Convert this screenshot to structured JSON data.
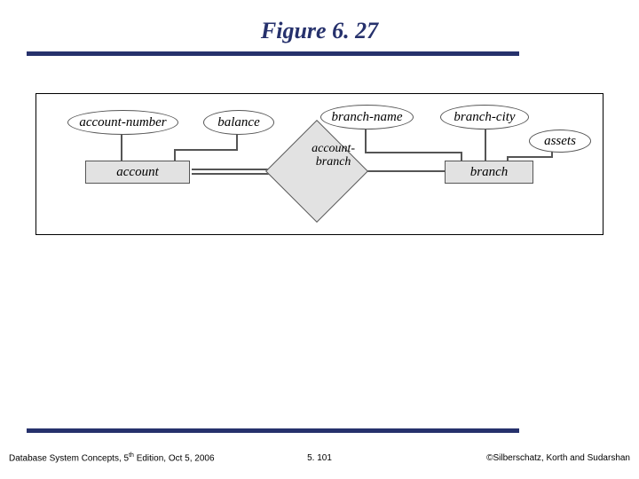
{
  "title": "Figure 6. 27",
  "er": {
    "attributes": {
      "account_number": "account-number",
      "balance": "balance",
      "branch_name": "branch-name",
      "branch_city": "branch-city",
      "assets": "assets"
    },
    "entities": {
      "account": "account",
      "branch": "branch"
    },
    "relationships": {
      "account_branch": "account-\nbranch"
    }
  },
  "footer": {
    "left_pre": "Database System Concepts, 5",
    "left_sup": "th",
    "left_post": " Edition, Oct 5, 2006",
    "center": "5. 101",
    "right": "©Silberschatz, Korth and Sudarshan"
  }
}
